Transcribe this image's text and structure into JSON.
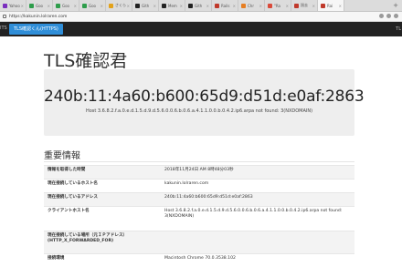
{
  "browser": {
    "tabs": [
      {
        "label": "Yahoo",
        "color": "#7b2fbe"
      },
      {
        "label": "Goo",
        "color": "#2e9d4b"
      },
      {
        "label": "Goo",
        "color": "#2e9d4b"
      },
      {
        "label": "Goo",
        "color": "#2e9d4b"
      },
      {
        "label": "さくら",
        "color": "#e3a21a"
      },
      {
        "label": "Gith",
        "color": "#222222"
      },
      {
        "label": "Mem",
        "color": "#222222"
      },
      {
        "label": "Gith",
        "color": "#222222"
      },
      {
        "label": "Rails",
        "color": "#c0392b"
      },
      {
        "label": "Chr",
        "color": "#e67e22"
      },
      {
        "label": "\"Ra",
        "color": "#d94a3a"
      },
      {
        "label": "過去",
        "color": "#c0392b"
      },
      {
        "label": "Rai",
        "color": "#c0392b"
      }
    ],
    "active_tab_index": 12,
    "url": "https://kakunin.lolraren.com"
  },
  "navbar": {
    "left_text": "ITS",
    "brand": "TLS確認くん(HTTPS)",
    "right_text": "TL"
  },
  "page": {
    "title": "TLS確認君",
    "ip_address": "240b:11:4a60:b600:65d9:d51d:e0af:2863",
    "host_lookup": "Host 3.6.8.2.f.a.0.e.d.1.5.d.9.d.5.6.0.0.6.b.0.6.a.4.1.1.0.0.b.0.4.2.ip6.arpa not found: 3(NXDOMAIN)",
    "section_title": "重要情報"
  },
  "info_table": [
    {
      "key": "情報を取得した時間",
      "value": "2018年11月24日 AM 8時48分03秒"
    },
    {
      "key": "現在接続しているホスト名",
      "value": "kakunin.lolraren.com"
    },
    {
      "key": "現在接続しているアドレス",
      "value": "240b:11:4a60:b600:65d9:d51d:e0af:2863"
    },
    {
      "key": "クライアントホスト名",
      "value": "Host 3.6.8.2.f.a.0.e.d.1.5.d.9.d.5.6.0.0.6.b.0.6.a.4.1.1.0.0.b.0.4.2.ip6.arpa not found: 3(NXDOMAIN)"
    },
    {
      "key": "現在接続している場所（元ＩＰアドレス）(HTTP_X_FORWARDED_FOR)",
      "value": ""
    },
    {
      "key": "接続環境",
      "value": "Macintosh Chrome 70.0.3538.102"
    }
  ]
}
